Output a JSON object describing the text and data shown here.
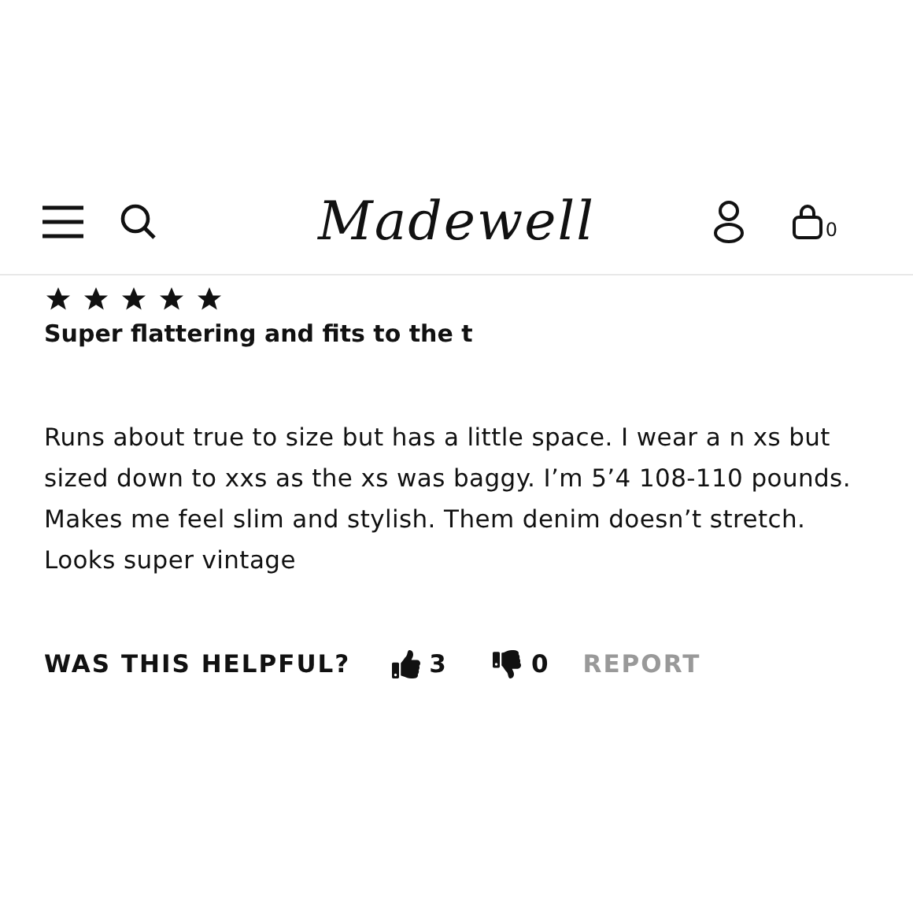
{
  "header": {
    "logo": "Madewell",
    "bag_count": "0"
  },
  "review": {
    "stars": 5,
    "title": "Super flattering and fits to the t",
    "body": "Runs about true to size but has a little space. I wear a n xs but sized down to xxs as the xs was baggy. I’m 5’4 108-110 pounds. Makes me feel slim and stylish. Them denim doesn’t stretch. Looks super vintage"
  },
  "helpful": {
    "label": "WAS THIS HELPFUL?",
    "upvotes": "3",
    "downvotes": "0",
    "report": "REPORT"
  }
}
